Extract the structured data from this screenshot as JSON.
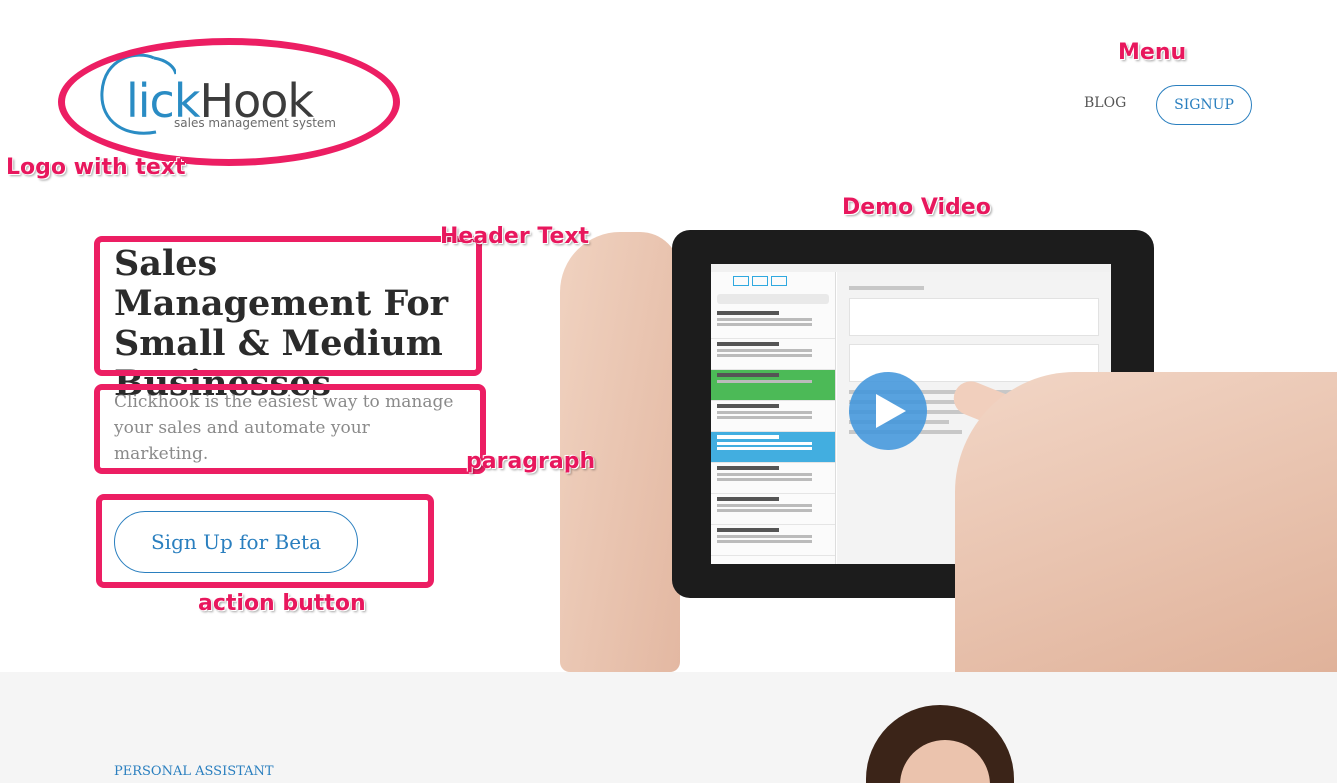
{
  "logo": {
    "brand_first": "C",
    "brand_lick": "lick",
    "brand_hook": "Hook",
    "tagline": "sales management system"
  },
  "nav": {
    "blog": "BLOG",
    "signup": "SIGNUP"
  },
  "hero": {
    "title": "Sales Management For Small & Medium Businesses",
    "paragraph": "Clickhook is the easiest way to manage your sales and automate your marketing.",
    "cta": "Sign Up for Beta"
  },
  "section2": {
    "label": "PERSONAL ASSISTANT"
  },
  "annotations": {
    "menu": "Menu",
    "logo": "Logo with text",
    "demo_video": "Demo Video",
    "header_text": "Header Text",
    "paragraph": "paragraph",
    "action_button": "action button"
  },
  "colors": {
    "annotation": "#ec1e63",
    "brand_blue": "#2a7fbf"
  }
}
